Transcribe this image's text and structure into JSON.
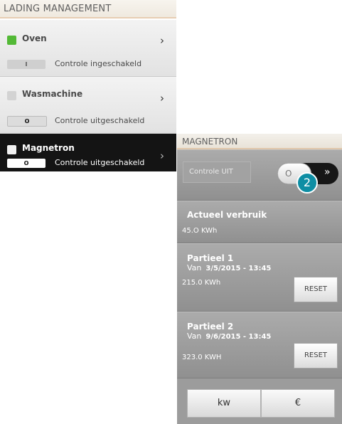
{
  "left": {
    "title": "LADING MANAGEMENT",
    "devices": [
      {
        "name": "Oven",
        "toggle": "I",
        "status": "Controle ingeschakeld",
        "indicator_color": "#53b936"
      },
      {
        "name": "Wasmachine",
        "toggle": "O",
        "status": "Controle uitgeschakeld",
        "indicator_color": "#d3d3d3"
      },
      {
        "name": "Magnetron",
        "toggle": "O",
        "status": "Controle uitgeschakeld",
        "indicator_color": "#f2f2f2",
        "selected": true
      }
    ],
    "chevron": "›"
  },
  "right": {
    "title": "MAGNETRON",
    "controle_label": "Controle UIT",
    "toggle_knob": "O",
    "toggle_arrows": "»",
    "callout": "2",
    "actueel": {
      "title": "Actueel verbruik",
      "value": "45.O KWh"
    },
    "partieel1": {
      "title": "Partieel 1",
      "van": "Van",
      "date": "3/5/2015 - 13:45",
      "value": "215.0 KWh",
      "reset": "RESET"
    },
    "partieel2": {
      "title": "Partieel 2",
      "van": "Van",
      "date": "9/6/2015 - 13:45",
      "value": "323.0 KWH",
      "reset": "RESET"
    },
    "units": {
      "kw": "kw",
      "euro": "€"
    }
  },
  "colors": {
    "accent_badge": "#0e8ea4",
    "active_green": "#53b936",
    "selected_bg": "#141414"
  }
}
